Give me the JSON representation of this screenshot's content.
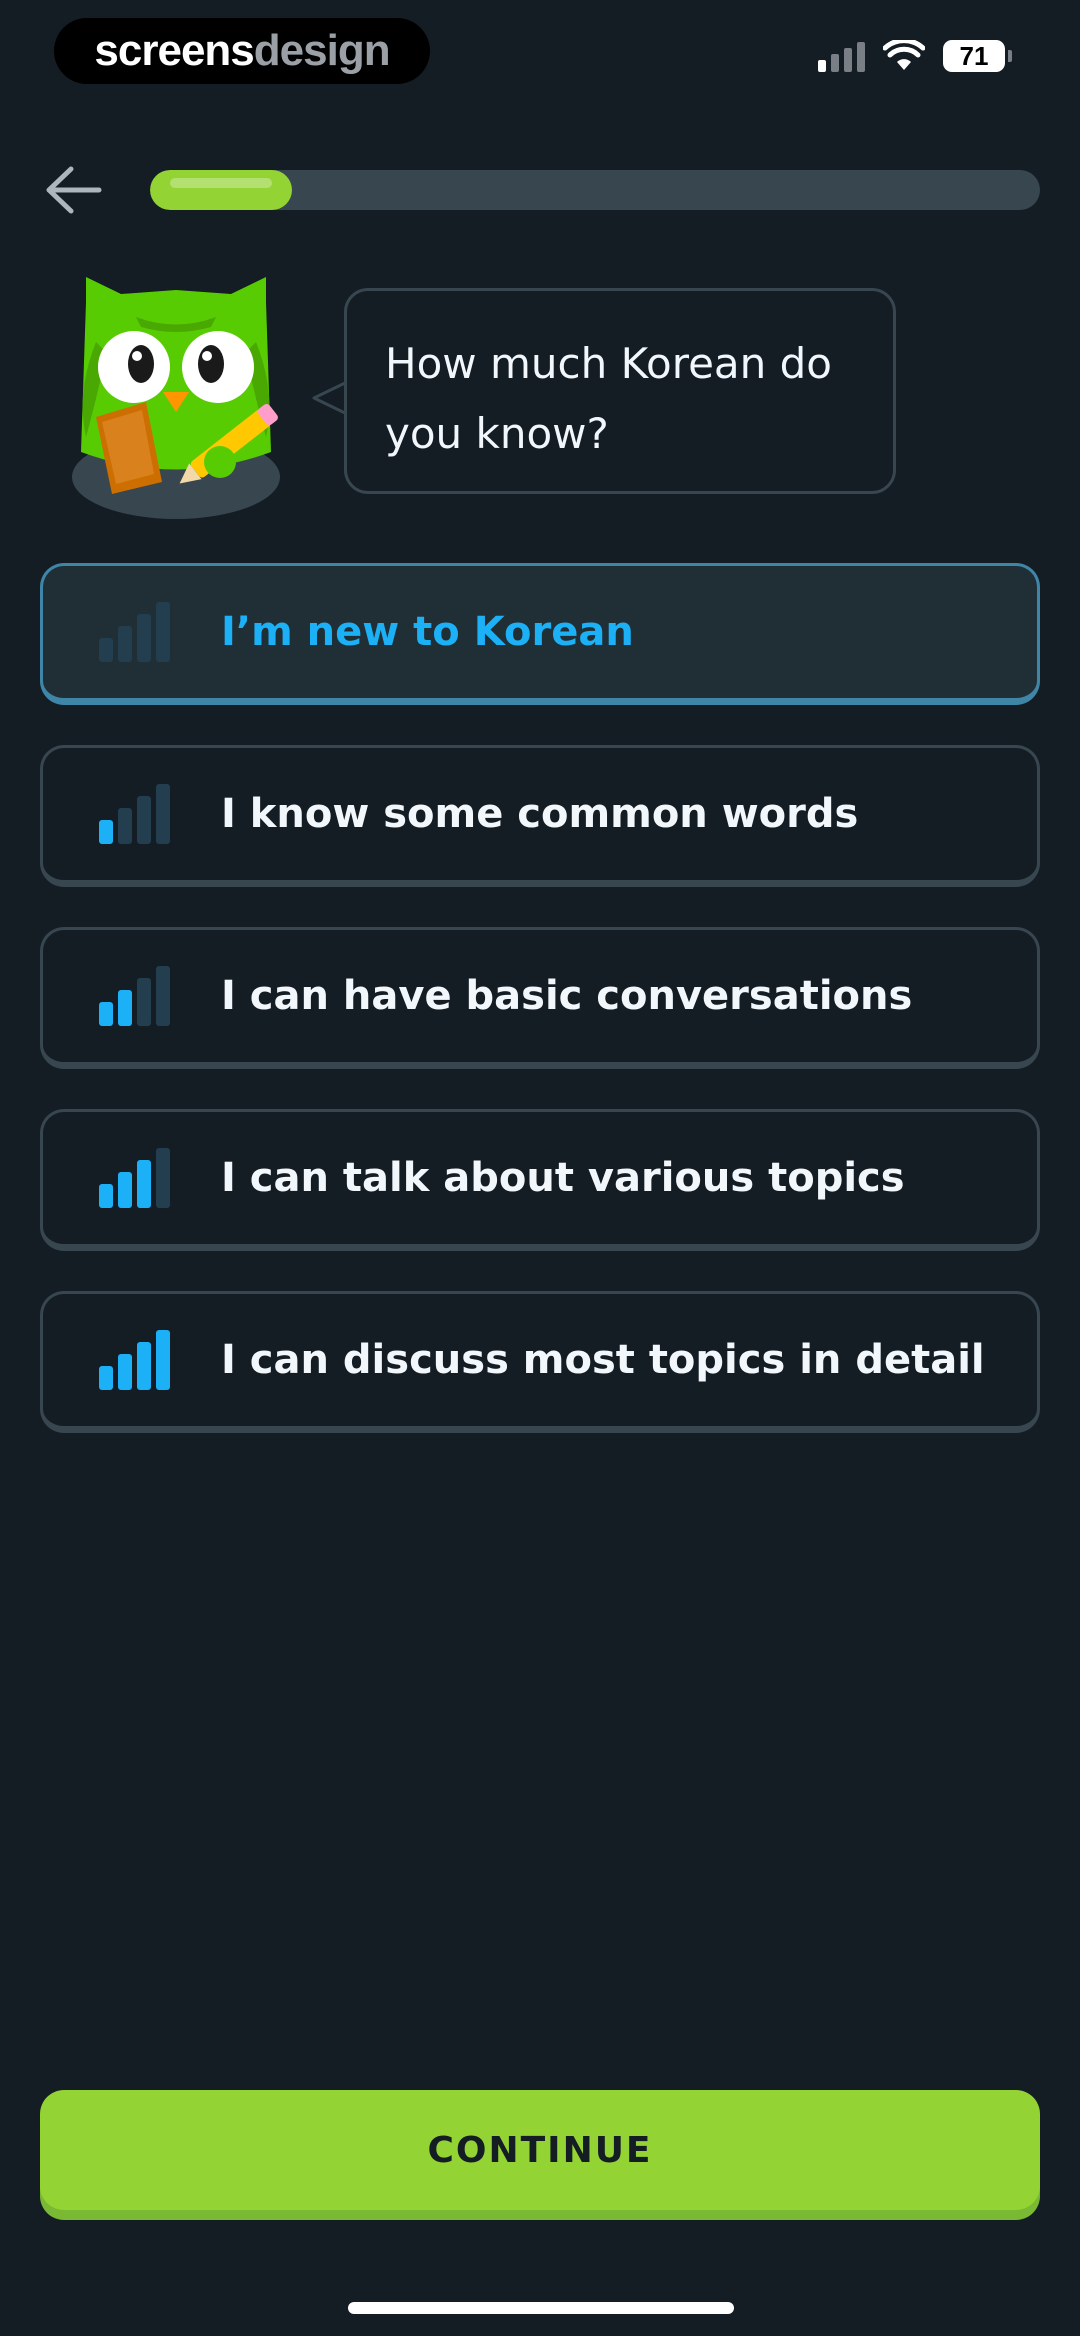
{
  "watermark": {
    "part1": "screens",
    "part2": "design"
  },
  "status_bar": {
    "battery": "71"
  },
  "progress": {
    "fraction": 0.16
  },
  "speech": {
    "text": "How much Korean do you know?"
  },
  "options": [
    {
      "label": "I’m new to Korean",
      "level": 0,
      "selected": true
    },
    {
      "label": "I know some common words",
      "level": 1,
      "selected": false
    },
    {
      "label": "I can have basic conversations",
      "level": 2,
      "selected": false
    },
    {
      "label": "I can talk about various topics",
      "level": 3,
      "selected": false
    },
    {
      "label": "I can discuss most topics in detail",
      "level": 4,
      "selected": false
    }
  ],
  "continue_label": "CONTINUE",
  "colors": {
    "background": "#141c24",
    "accent_green": "#93d333",
    "accent_blue": "#1cb0f6",
    "border": "#37464f"
  },
  "icons": {
    "back": "arrow-left-icon",
    "level": "signal-bars-icon",
    "wifi": "wifi-icon",
    "cell": "cell-signal-icon",
    "battery": "battery-icon",
    "mascot": "owl-mascot"
  }
}
